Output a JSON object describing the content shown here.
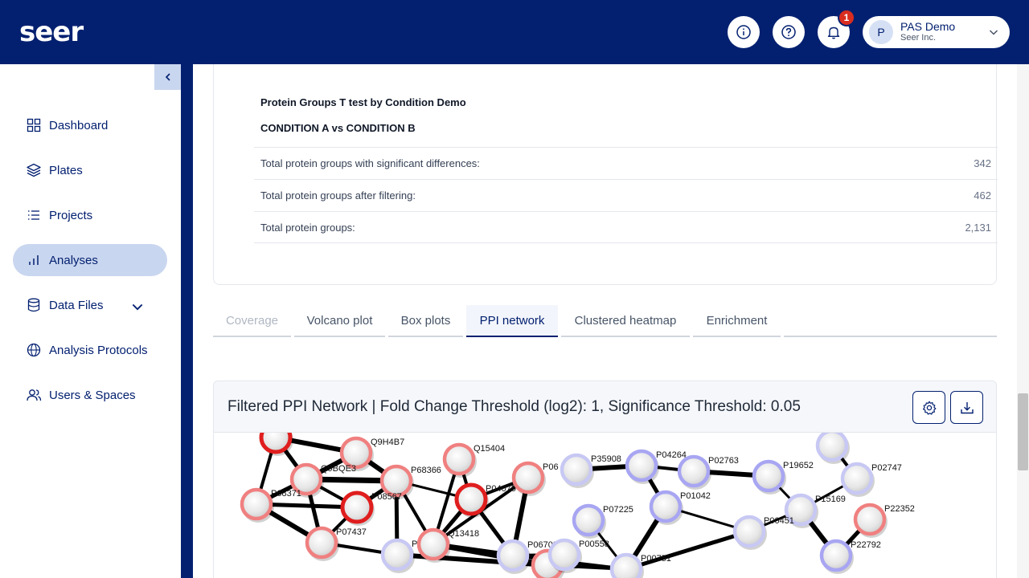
{
  "header": {
    "logo": "seer",
    "notification_count": "1",
    "user": {
      "initial": "P",
      "name": "PAS Demo",
      "org": "Seer Inc."
    }
  },
  "sidebar": {
    "items": [
      {
        "label": "Dashboard",
        "icon": "grid-icon"
      },
      {
        "label": "Plates",
        "icon": "layers-icon"
      },
      {
        "label": "Projects",
        "icon": "list-icon"
      },
      {
        "label": "Analyses",
        "icon": "bar-chart-icon",
        "active": true
      },
      {
        "label": "Data Files",
        "icon": "database-icon"
      },
      {
        "label": "Analysis Protocols",
        "icon": "globe-icon"
      },
      {
        "label": "Users & Spaces",
        "icon": "users-icon"
      }
    ]
  },
  "summary": {
    "title": "Protein Groups T test by Condition Demo",
    "comparison": "CONDITION A vs CONDITION B",
    "rows": [
      {
        "label": "Total protein groups with significant differences:",
        "value": "342"
      },
      {
        "label": "Total protein groups after filtering:",
        "value": "462"
      },
      {
        "label": "Total protein groups:",
        "value": "2,131"
      }
    ]
  },
  "tabs": [
    {
      "label": "Coverage",
      "state": "disabled"
    },
    {
      "label": "Volcano plot",
      "state": "normal"
    },
    {
      "label": "Box plots",
      "state": "normal"
    },
    {
      "label": "PPI network",
      "state": "active"
    },
    {
      "label": "Clustered heatmap",
      "state": "normal"
    },
    {
      "label": "Enrichment",
      "state": "normal"
    }
  ],
  "network": {
    "title": "Filtered PPI Network | Fold Change Threshold (log2): 1, Significance Threshold: 0.05",
    "colors": {
      "up_strong": "#e01e1e",
      "up": "#f08080",
      "down": "#a8a6f2",
      "down_light": "#c8c8f4",
      "edge": "#000000"
    },
    "nodes": [
      {
        "id": "n1",
        "label": "",
        "kind": "up_strong"
      },
      {
        "id": "n2",
        "label": "Q9H4B7",
        "kind": "up"
      },
      {
        "id": "n3",
        "label": "Q9BQE3",
        "kind": "up"
      },
      {
        "id": "n4",
        "label": "P68366",
        "kind": "up"
      },
      {
        "id": "n5",
        "label": "P68371",
        "kind": "up"
      },
      {
        "id": "n6",
        "label": "P08567",
        "kind": "up_strong"
      },
      {
        "id": "n7",
        "label": "P07437",
        "kind": "up"
      },
      {
        "id": "n8",
        "label": "Q15404",
        "kind": "up"
      },
      {
        "id": "n9",
        "label": "P04075",
        "kind": "up_strong"
      },
      {
        "id": "n10",
        "label": "P06",
        "kind": "up"
      },
      {
        "id": "n11",
        "label": "Q13418",
        "kind": "up"
      },
      {
        "id": "n12",
        "label": "P",
        "kind": "down_light"
      },
      {
        "id": "n13",
        "label": "P06702",
        "kind": "down_light"
      },
      {
        "id": "n14",
        "label": "",
        "kind": "up"
      },
      {
        "id": "n15",
        "label": "P00558",
        "kind": "down_light"
      },
      {
        "id": "n16",
        "label": "P35908",
        "kind": "down_light"
      },
      {
        "id": "n17",
        "label": "P04264",
        "kind": "down"
      },
      {
        "id": "n18",
        "label": "P02763",
        "kind": "down"
      },
      {
        "id": "n19",
        "label": "P07225",
        "kind": "down"
      },
      {
        "id": "n20",
        "label": "P01042",
        "kind": "down"
      },
      {
        "id": "n21",
        "label": "P19652",
        "kind": "down"
      },
      {
        "id": "n22",
        "label": "",
        "kind": "down_light"
      },
      {
        "id": "n23",
        "label": "P02747",
        "kind": "down_light"
      },
      {
        "id": "n24",
        "label": "P15169",
        "kind": "down_light"
      },
      {
        "id": "n25",
        "label": "P22352",
        "kind": "up"
      },
      {
        "id": "n26",
        "label": "P00451",
        "kind": "down_light"
      },
      {
        "id": "n27",
        "label": "P22792",
        "kind": "down"
      },
      {
        "id": "n28",
        "label": "P00751",
        "kind": "down_light"
      }
    ]
  }
}
